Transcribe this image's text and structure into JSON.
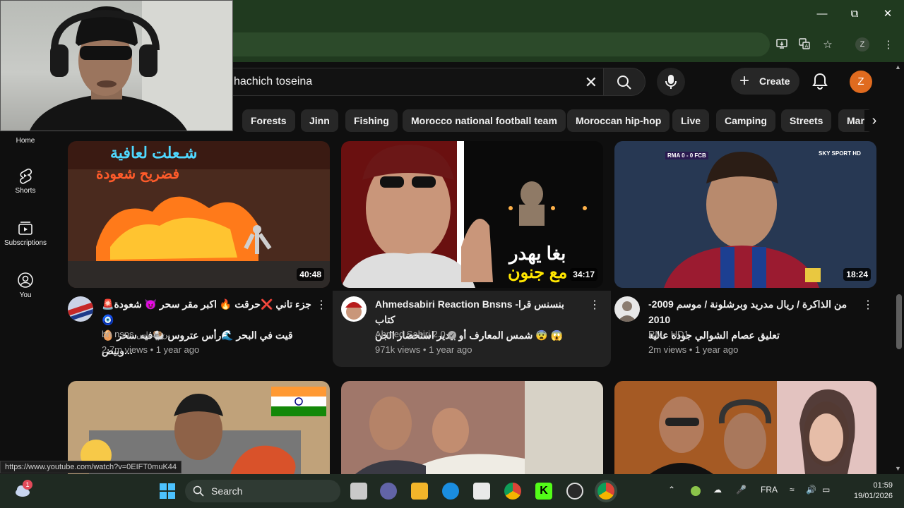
{
  "window": {
    "minimize_icon": "minimize-icon",
    "restore_icon": "restore-icon",
    "close_icon": "close-icon"
  },
  "browser": {
    "profile_initial": "Z",
    "status_url": "https://www.youtube.com/watch?v=0EIFT0muK44"
  },
  "youtube": {
    "search_value": "hachich toseina",
    "create_label": "Create",
    "avatar_initial": "Z",
    "chips": [
      "Forests",
      "Jinn",
      "Fishing",
      "Morocco national football team",
      "Moroccan hip-hop",
      "Live",
      "Camping",
      "Streets",
      "Mar"
    ],
    "nav": [
      {
        "label": "Home",
        "icon": "home-icon"
      },
      {
        "label": "Shorts",
        "icon": "shorts-icon"
      },
      {
        "label": "Subscriptions",
        "icon": "subscriptions-icon"
      },
      {
        "label": "You",
        "icon": "user-icon"
      }
    ],
    "videos": [
      {
        "duration": "40:48",
        "overlay_text_1": "شـعلت لعافية",
        "overlay_text_2": "فضريح شعودة",
        "title_line1": "🚨جزء تاني ❌حرقت 🔥 اكبر مقر سحر 😈 شعودة 🧿",
        "title_line2": "🥚 قيت في البحر 🌊رأس عتروس 🐏فيه سحر وبيض...",
        "channel": "bn nsns",
        "channel_suffix": "بن نسناس",
        "stats": "2.7m views • 1 year ago"
      },
      {
        "duration": "34:17",
        "overlay_text_1": "بغا يهدر",
        "overlay_text_2": "مع جنون",
        "title_line1": "Ahmedsabiri Reaction Bnsns -بنسنس قرا كتاب",
        "title_line2": "شمس المعارف أو بيدير استحضار الجن 😨 😱",
        "channel": "Ahmed Sabiri 2.0",
        "stats": "971k views • 1 year ago"
      },
      {
        "duration": "18:24",
        "overlay_text_1": "RMA 0 - 0 FCB",
        "overlay_text_2": "SKY SPORT HD",
        "title_line1": "من الذاكرة / ريال مدريد وبرشلونة / موسم 2009-2010",
        "title_line2": "تعليق عصام الشوالي جودة عالية",
        "channel": "RM - HD1",
        "stats": "2m views • 1 year ago"
      }
    ]
  },
  "taskbar": {
    "search_label": "Search",
    "language": "FRA",
    "time": "01:59",
    "date": "19/01/2026",
    "weather_badge": "1"
  },
  "colors": {
    "chrome_frame": "#203a1f",
    "yt_background": "#0f0f0f",
    "chip_bg": "#272727",
    "avatar_orange": "#e06b1f",
    "taskbar": "#1f2a22"
  }
}
